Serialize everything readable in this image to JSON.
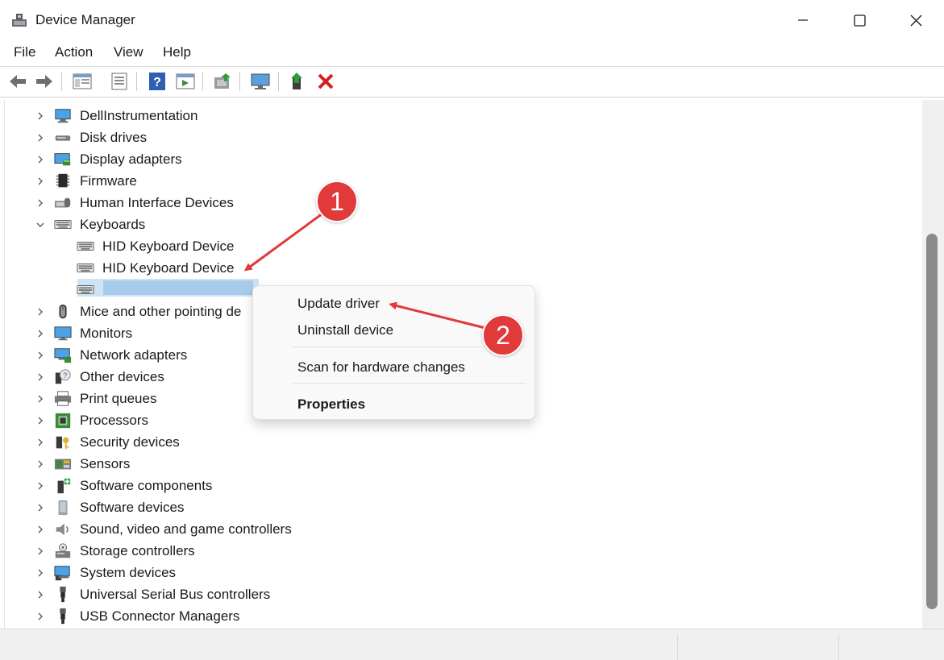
{
  "window": {
    "title": "Device Manager",
    "controls": {
      "minimize": "minimize",
      "maximize": "maximize",
      "close": "close"
    }
  },
  "menu": [
    "File",
    "Action",
    "View",
    "Help"
  ],
  "toolbar": {
    "icons": [
      "back-arrow-icon",
      "forward-arrow-icon",
      "show-hide-console-tree-icon",
      "properties-icon",
      "help-icon",
      "action-pane-icon",
      "scan-hardware-icon",
      "monitor-icon",
      "update-driver-icon",
      "uninstall-device-icon"
    ]
  },
  "tree": {
    "items": [
      {
        "label": "DellInstrumentation",
        "expanded": false,
        "icon": "computer-icon"
      },
      {
        "label": "Disk drives",
        "expanded": false,
        "icon": "disk-drive-icon"
      },
      {
        "label": "Display adapters",
        "expanded": false,
        "icon": "display-adapter-icon"
      },
      {
        "label": "Firmware",
        "expanded": false,
        "icon": "firmware-chip-icon"
      },
      {
        "label": "Human Interface Devices",
        "expanded": false,
        "icon": "hid-icon"
      },
      {
        "label": "Keyboards",
        "expanded": true,
        "icon": "keyboard-icon"
      },
      {
        "label": "HID Keyboard Device",
        "child": true,
        "icon": "keyboard-icon"
      },
      {
        "label": "HID Keyboard Device",
        "child": true,
        "icon": "keyboard-icon"
      },
      {
        "label": "",
        "child": true,
        "selected": true,
        "icon": "keyboard-icon"
      },
      {
        "label": "Mice and other pointing de",
        "expanded": false,
        "icon": "mouse-icon"
      },
      {
        "label": "Monitors",
        "expanded": false,
        "icon": "monitor-icon"
      },
      {
        "label": "Network adapters",
        "expanded": false,
        "icon": "network-adapter-icon"
      },
      {
        "label": "Other devices",
        "expanded": false,
        "icon": "unknown-device-icon"
      },
      {
        "label": "Print queues",
        "expanded": false,
        "icon": "printer-icon"
      },
      {
        "label": "Processors",
        "expanded": false,
        "icon": "processor-icon"
      },
      {
        "label": "Security devices",
        "expanded": false,
        "icon": "security-key-icon"
      },
      {
        "label": "Sensors",
        "expanded": false,
        "icon": "sensor-icon"
      },
      {
        "label": "Software components",
        "expanded": false,
        "icon": "software-component-icon"
      },
      {
        "label": "Software devices",
        "expanded": false,
        "icon": "software-device-icon"
      },
      {
        "label": "Sound, video and game controllers",
        "expanded": false,
        "icon": "speaker-icon"
      },
      {
        "label": "Storage controllers",
        "expanded": false,
        "icon": "storage-controller-icon"
      },
      {
        "label": "System devices",
        "expanded": false,
        "icon": "system-device-icon"
      },
      {
        "label": "Universal Serial Bus controllers",
        "expanded": false,
        "icon": "usb-icon"
      },
      {
        "label": "USB Connector Managers",
        "expanded": false,
        "icon": "usb-icon"
      }
    ]
  },
  "context_menu": {
    "items": [
      "Update driver",
      "Uninstall device",
      "Scan for hardware changes",
      "Properties"
    ]
  },
  "annotations": {
    "step1": "1",
    "step2": "2"
  },
  "colors": {
    "accent": "#0067c0",
    "selection": "#cce4f7",
    "annotation": "#e03a3a"
  }
}
